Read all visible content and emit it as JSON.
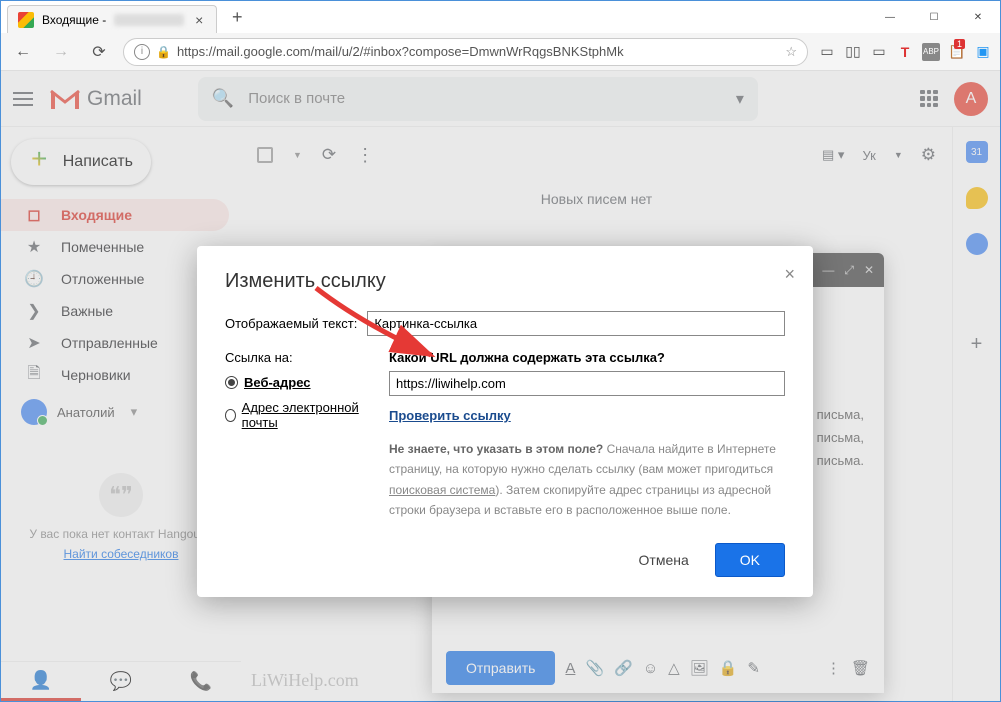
{
  "browser": {
    "tab_title": "Входящие -",
    "url": "https://mail.google.com/mail/u/2/#inbox?compose=DmwnWrRqgsBNKStphMk"
  },
  "gmail": {
    "logo_text": "Gmail",
    "search_placeholder": "Поиск в почте",
    "avatar_letter": "А",
    "compose_label": "Написать",
    "sidebar": {
      "inbox": "Входящие",
      "starred": "Помеченные",
      "snoozed": "Отложенные",
      "important": "Важные",
      "sent": "Отправленные",
      "drafts": "Черновики"
    },
    "user_name": "Анатолий",
    "hangouts_text": "У вас пока нет контакт Hangouts.",
    "hangouts_link": "Найти собеседников",
    "lang_label": "Ук",
    "no_mail": "Новых писем нет",
    "body_sample": "текст письма,",
    "body_sample_end": "текст письма.",
    "send_label": "Отправить"
  },
  "dialog": {
    "title": "Изменить ссылку",
    "display_text_label": "Отображаемый текст:",
    "display_text_value": "Картинка-ссылка",
    "link_to_label": "Ссылка на:",
    "radio_web": "Веб-адрес",
    "radio_email": "Адрес электронной почты",
    "url_question": "Какой URL должна содержать эта ссылка?",
    "url_value": "https://liwihelp.com",
    "test_link": "Проверить ссылку",
    "hint_bold": "Не знаете, что указать в этом поле?",
    "hint_part1": " Сначала найдите в Интернете страницу, на которую нужно сделать ссылку (вам может пригодиться ",
    "hint_search": "поисковая система",
    "hint_part2": "). Затем скопируйте адрес страницы из адресной строки браузера и вставьте его в расположенное выше поле.",
    "cancel": "Отмена",
    "ok": "OK"
  },
  "watermark": "LiWiHelp.com"
}
